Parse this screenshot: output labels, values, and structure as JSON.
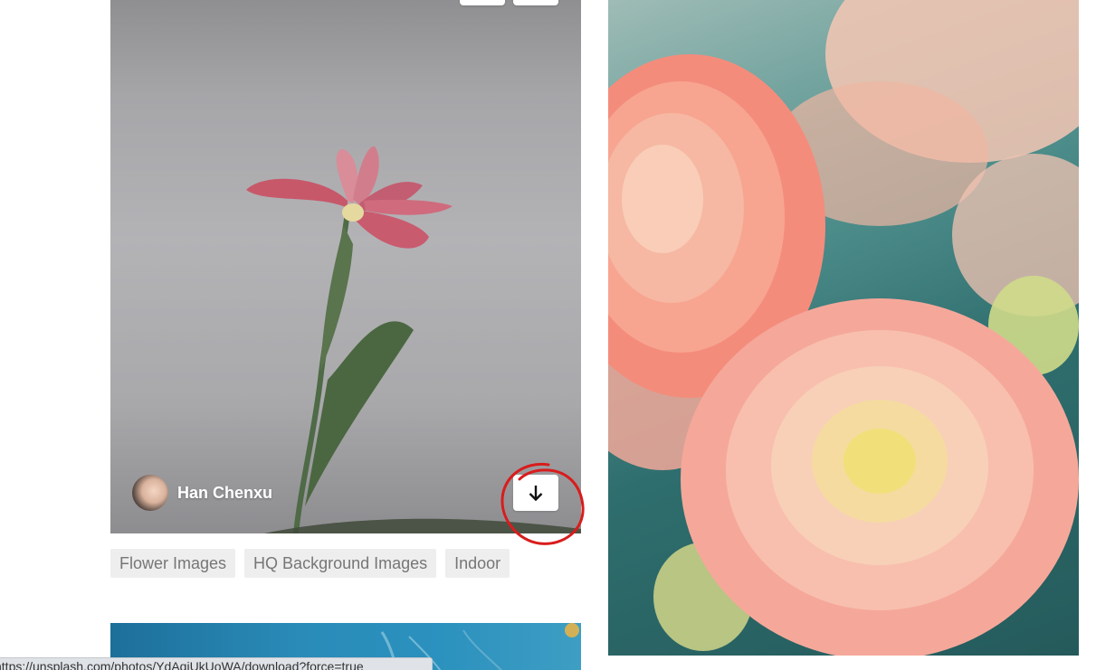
{
  "left_photo": {
    "author_name": "Han Chenxu",
    "tags": [
      "Flower Images",
      "HQ Background Images",
      "Indoor"
    ]
  },
  "status_bar": {
    "url": "https://unsplash.com/photos/YdAqiUkUoWA/download?force=true"
  },
  "icons": {
    "download": "arrow-down-icon",
    "annotation": "red-circle-annotation"
  },
  "colors": {
    "annotation_red": "#d91c1c",
    "tag_bg": "#eeeeee",
    "tag_text": "#767676"
  }
}
